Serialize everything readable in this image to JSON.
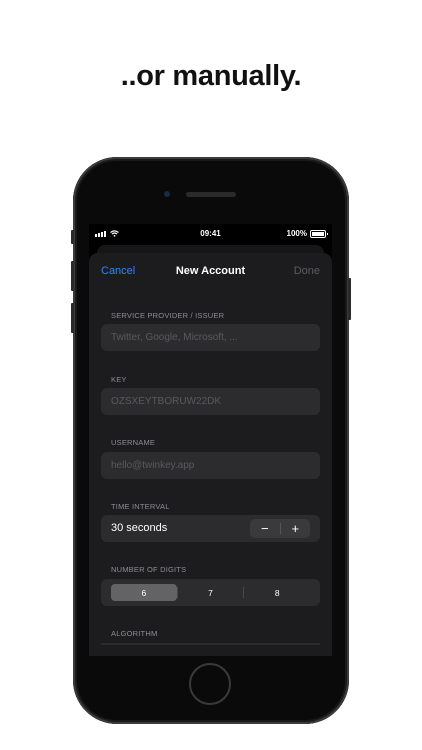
{
  "headline": "..or manually.",
  "statusbar": {
    "time": "09:41",
    "battery": "100%"
  },
  "nav": {
    "cancel": "Cancel",
    "title": "New Account",
    "done": "Done"
  },
  "form": {
    "service": {
      "label": "SERVICE PROVIDER / ISSUER",
      "placeholder": "Twitter, Google, Microsoft, ..."
    },
    "key": {
      "label": "KEY",
      "placeholder": "OZSXEYTBORUW22DK"
    },
    "username": {
      "label": "USERNAME",
      "placeholder": "hello@twinkey.app"
    },
    "interval": {
      "label": "TIME INTERVAL",
      "value": "30 seconds",
      "minus": "−",
      "plus": "+"
    },
    "digits": {
      "label": "NUMBER OF DIGITS",
      "options": [
        "6",
        "7",
        "8"
      ],
      "selected": "6"
    },
    "algorithm": {
      "label": "ALGORITHM"
    }
  },
  "colors": {
    "accent": "#2f86f5",
    "sheet": "#1c1c1e",
    "field": "#2c2c2e"
  },
  "icons": [
    "signal-icon",
    "wifi-icon",
    "battery-icon",
    "minus-icon",
    "plus-icon"
  ]
}
